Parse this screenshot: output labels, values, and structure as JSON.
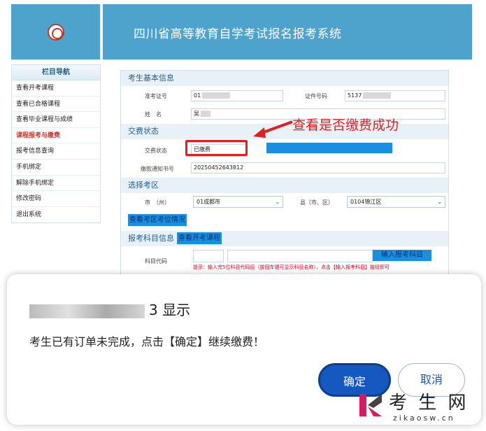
{
  "header": {
    "system_title": "四川省高等教育自学考试报名报考系统"
  },
  "sidebar": {
    "heading": "栏目导航",
    "items": [
      {
        "label": "查看开考课程"
      },
      {
        "label": "查看已合格课程"
      },
      {
        "label": "查看毕业课程与成绩"
      },
      {
        "label": "课程报考与缴费"
      },
      {
        "label": "报考信息查询"
      },
      {
        "label": "手机绑定"
      },
      {
        "label": "解除手机绑定"
      },
      {
        "label": "修改密码"
      },
      {
        "label": "退出系统"
      }
    ],
    "active_index": 3
  },
  "form": {
    "basic_section": "考生基本信息",
    "admission_label": "准考证号",
    "admission_value": "01",
    "id_label": "证件号码",
    "id_value": "5137",
    "name_label": "姓　名",
    "name_value": "吴",
    "fee_section": "交费状态",
    "fee_status_label": "交费状态",
    "fee_status_value": "已缴费",
    "notice_label": "缴款通知书号",
    "notice_value": "20250452643812",
    "exam_section": "选择考区",
    "city_label": "市　（州）",
    "city_value": "01成都市",
    "county_label": "县（市、区）",
    "county_value": "0104锦江区",
    "view_site_link": "查看考区考位情况",
    "subject_section": "报考科目信息",
    "view_courses_link": "查看开考课程",
    "subject_code_label": "科目代码",
    "enter_subject_button": "输入报考科目",
    "hint_text": "提示：输入完5位科目代码后（按回车键可显示科目名称），点击【输入报考科目】按钮即可"
  },
  "annotation": {
    "text": "查看是否缴费成功"
  },
  "dialog": {
    "title_suffix": "3 显示",
    "message": "考生已有订单未完成，点击【确定】继续缴费！",
    "ok_label": "确定",
    "cancel_label": "取消"
  },
  "watermark": {
    "text": "考 生 网",
    "url": "zikaosw.cn"
  },
  "colors": {
    "header_blue": "#4da3cc",
    "accent_red": "#e02020",
    "button_blue": "#1558c0"
  }
}
